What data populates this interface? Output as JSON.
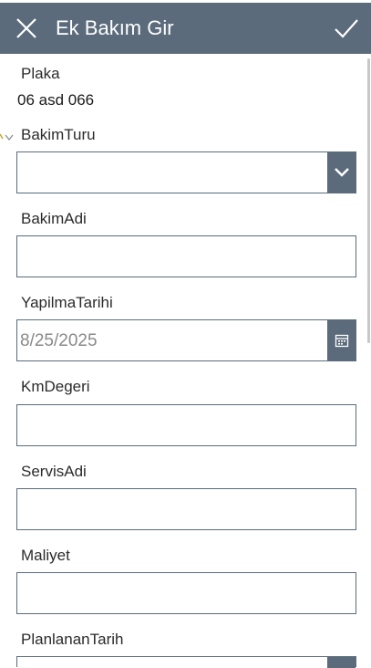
{
  "header": {
    "title": "Ek Bakım Gir"
  },
  "form": {
    "plaka": {
      "label": "Plaka",
      "value": "06 asd 066"
    },
    "bakim_turu": {
      "label": "BakimTuru",
      "value": ""
    },
    "bakim_adi": {
      "label": "BakimAdi",
      "value": ""
    },
    "yapilma_tarihi": {
      "label": "YapilmaTarihi",
      "value": "8/25/2025"
    },
    "km_degeri": {
      "label": "KmDegeri",
      "value": ""
    },
    "servis_adi": {
      "label": "ServisAdi",
      "value": ""
    },
    "maliyet": {
      "label": "Maliyet",
      "value": ""
    },
    "planlanan_tarih": {
      "label": "PlanlananTarih",
      "value": ""
    }
  },
  "icons": {
    "close": "close-icon",
    "check": "check-icon",
    "dropdown": "chevron-down-icon",
    "calendar": "calendar-icon"
  },
  "colors": {
    "header_bg": "#5b6b7b",
    "border": "#5b6b7b",
    "text": "#2b2b2b",
    "placeholder": "#8a8a8a"
  }
}
